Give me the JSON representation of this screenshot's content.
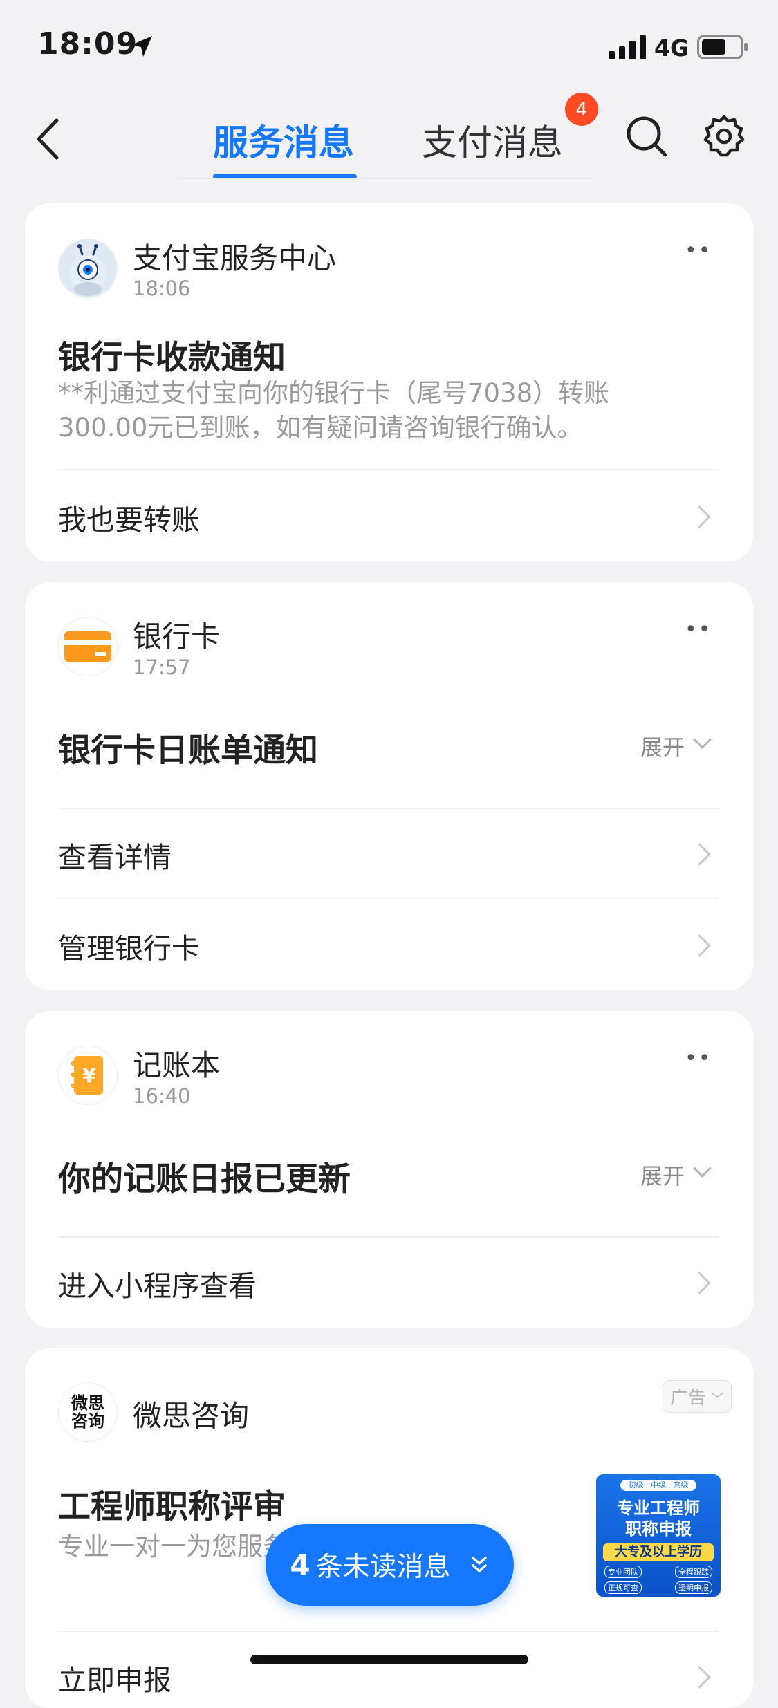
{
  "status_bar": {
    "time": "18:09",
    "network": "4G"
  },
  "header": {
    "tabs": [
      {
        "label": "服务消息",
        "active": true
      },
      {
        "label": "支付消息",
        "active": false,
        "badge": "4"
      }
    ]
  },
  "cards": [
    {
      "sender": "支付宝服务中心",
      "time": "18:06",
      "title": "银行卡收款通知",
      "body_line1": "**利通过支付宝向你的银行卡（尾号7038）转账",
      "body_line2": "300.00元已到账，如有疑问请咨询银行确认。",
      "actions": [
        "我也要转账"
      ]
    },
    {
      "sender": "银行卡",
      "time": "17:57",
      "title": "银行卡日账单通知",
      "expand_label": "展开",
      "actions": [
        "查看详情",
        "管理银行卡"
      ]
    },
    {
      "sender": "记账本",
      "time": "16:40",
      "title": "你的记账日报已更新",
      "expand_label": "展开",
      "actions": [
        "进入小程序查看"
      ]
    },
    {
      "sender": "微思咨询",
      "avatar_text": "微思咨询",
      "ad_label": "广告",
      "title": "工程师职称评审",
      "body": "专业一对一为您服务，欢迎咨询",
      "actions": [
        "立即申报"
      ],
      "ad_image": {
        "top": "初级 · 中级 · 高级",
        "line1": "专业工程师",
        "line2": "职称申报",
        "band": "大专及以上学历",
        "tags": [
          "专业团队",
          "全程跟踪",
          "正规可查",
          "透明申报"
        ]
      }
    }
  ],
  "unread_pill": {
    "count": "4",
    "label": "条未读消息"
  },
  "colors": {
    "accent": "#1677ff",
    "badge": "#ff4b24",
    "background": "#f2f2f4"
  }
}
